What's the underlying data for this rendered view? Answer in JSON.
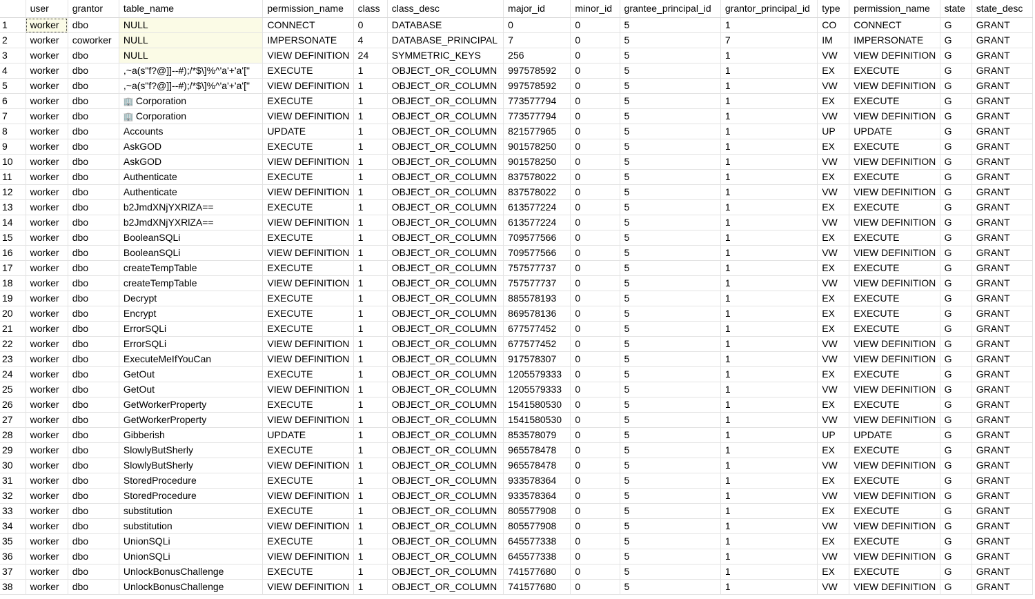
{
  "columns": [
    "",
    "user",
    "grantor",
    "table_name",
    "permission_name",
    "class",
    "class_desc",
    "major_id",
    "minor_id",
    "grantee_principal_id",
    "grantor_principal_id",
    "type",
    "permission_name",
    "state",
    "state_desc"
  ],
  "rows": [
    [
      "1",
      "worker",
      "dbo",
      "NULL",
      "CONNECT",
      "0",
      "DATABASE",
      "0",
      "0",
      "5",
      "1",
      "CO",
      "CONNECT",
      "G",
      "GRANT"
    ],
    [
      "2",
      "worker",
      "coworker",
      "NULL",
      "IMPERSONATE",
      "4",
      "DATABASE_PRINCIPAL",
      "7",
      "0",
      "5",
      "7",
      "IM",
      "IMPERSONATE",
      "G",
      "GRANT"
    ],
    [
      "3",
      "worker",
      "dbo",
      "NULL",
      "VIEW DEFINITION",
      "24",
      "SYMMETRIC_KEYS",
      "256",
      "0",
      "5",
      "1",
      "VW",
      "VIEW DEFINITION",
      "G",
      "GRANT"
    ],
    [
      "4",
      "worker",
      "dbo",
      " ,~a(s\"f?@]]--#);/*$\\]%^'a'+'a'[\"",
      "EXECUTE",
      "1",
      "OBJECT_OR_COLUMN",
      "997578592",
      "0",
      "5",
      "1",
      "EX",
      "EXECUTE",
      "G",
      "GRANT"
    ],
    [
      "5",
      "worker",
      "dbo",
      " ,~a(s\"f?@]]--#);/*$\\]%^'a'+'a'[\"",
      "VIEW DEFINITION",
      "1",
      "OBJECT_OR_COLUMN",
      "997578592",
      "0",
      "5",
      "1",
      "VW",
      "VIEW DEFINITION",
      "G",
      "GRANT"
    ],
    [
      "6",
      "worker",
      "dbo",
      "Corporation",
      "EXECUTE",
      "1",
      "OBJECT_OR_COLUMN",
      "773577794",
      "0",
      "5",
      "1",
      "EX",
      "EXECUTE",
      "G",
      "GRANT"
    ],
    [
      "7",
      "worker",
      "dbo",
      "Corporation",
      "VIEW DEFINITION",
      "1",
      "OBJECT_OR_COLUMN",
      "773577794",
      "0",
      "5",
      "1",
      "VW",
      "VIEW DEFINITION",
      "G",
      "GRANT"
    ],
    [
      "8",
      "worker",
      "dbo",
      "Accounts",
      "UPDATE",
      "1",
      "OBJECT_OR_COLUMN",
      "821577965",
      "0",
      "5",
      "1",
      "UP",
      "UPDATE",
      "G",
      "GRANT"
    ],
    [
      "9",
      "worker",
      "dbo",
      "AskGOD",
      "EXECUTE",
      "1",
      "OBJECT_OR_COLUMN",
      "901578250",
      "0",
      "5",
      "1",
      "EX",
      "EXECUTE",
      "G",
      "GRANT"
    ],
    [
      "10",
      "worker",
      "dbo",
      "AskGOD",
      "VIEW DEFINITION",
      "1",
      "OBJECT_OR_COLUMN",
      "901578250",
      "0",
      "5",
      "1",
      "VW",
      "VIEW DEFINITION",
      "G",
      "GRANT"
    ],
    [
      "11",
      "worker",
      "dbo",
      "Authenticate",
      "EXECUTE",
      "1",
      "OBJECT_OR_COLUMN",
      "837578022",
      "0",
      "5",
      "1",
      "EX",
      "EXECUTE",
      "G",
      "GRANT"
    ],
    [
      "12",
      "worker",
      "dbo",
      "Authenticate",
      "VIEW DEFINITION",
      "1",
      "OBJECT_OR_COLUMN",
      "837578022",
      "0",
      "5",
      "1",
      "VW",
      "VIEW DEFINITION",
      "G",
      "GRANT"
    ],
    [
      "13",
      "worker",
      "dbo",
      "b2JmdXNjYXRlZA==",
      "EXECUTE",
      "1",
      "OBJECT_OR_COLUMN",
      "613577224",
      "0",
      "5",
      "1",
      "EX",
      "EXECUTE",
      "G",
      "GRANT"
    ],
    [
      "14",
      "worker",
      "dbo",
      "b2JmdXNjYXRlZA==",
      "VIEW DEFINITION",
      "1",
      "OBJECT_OR_COLUMN",
      "613577224",
      "0",
      "5",
      "1",
      "VW",
      "VIEW DEFINITION",
      "G",
      "GRANT"
    ],
    [
      "15",
      "worker",
      "dbo",
      "BooleanSQLi",
      "EXECUTE",
      "1",
      "OBJECT_OR_COLUMN",
      "709577566",
      "0",
      "5",
      "1",
      "EX",
      "EXECUTE",
      "G",
      "GRANT"
    ],
    [
      "16",
      "worker",
      "dbo",
      "BooleanSQLi",
      "VIEW DEFINITION",
      "1",
      "OBJECT_OR_COLUMN",
      "709577566",
      "0",
      "5",
      "1",
      "VW",
      "VIEW DEFINITION",
      "G",
      "GRANT"
    ],
    [
      "17",
      "worker",
      "dbo",
      "createTempTable",
      "EXECUTE",
      "1",
      "OBJECT_OR_COLUMN",
      "757577737",
      "0",
      "5",
      "1",
      "EX",
      "EXECUTE",
      "G",
      "GRANT"
    ],
    [
      "18",
      "worker",
      "dbo",
      "createTempTable",
      "VIEW DEFINITION",
      "1",
      "OBJECT_OR_COLUMN",
      "757577737",
      "0",
      "5",
      "1",
      "VW",
      "VIEW DEFINITION",
      "G",
      "GRANT"
    ],
    [
      "19",
      "worker",
      "dbo",
      "Decrypt",
      "EXECUTE",
      "1",
      "OBJECT_OR_COLUMN",
      "885578193",
      "0",
      "5",
      "1",
      "EX",
      "EXECUTE",
      "G",
      "GRANT"
    ],
    [
      "20",
      "worker",
      "dbo",
      "Encrypt",
      "EXECUTE",
      "1",
      "OBJECT_OR_COLUMN",
      "869578136",
      "0",
      "5",
      "1",
      "EX",
      "EXECUTE",
      "G",
      "GRANT"
    ],
    [
      "21",
      "worker",
      "dbo",
      "ErrorSQLi",
      "EXECUTE",
      "1",
      "OBJECT_OR_COLUMN",
      "677577452",
      "0",
      "5",
      "1",
      "EX",
      "EXECUTE",
      "G",
      "GRANT"
    ],
    [
      "22",
      "worker",
      "dbo",
      "ErrorSQLi",
      "VIEW DEFINITION",
      "1",
      "OBJECT_OR_COLUMN",
      "677577452",
      "0",
      "5",
      "1",
      "VW",
      "VIEW DEFINITION",
      "G",
      "GRANT"
    ],
    [
      "23",
      "worker",
      "dbo",
      "ExecuteMeIfYouCan",
      "VIEW DEFINITION",
      "1",
      "OBJECT_OR_COLUMN",
      "917578307",
      "0",
      "5",
      "1",
      "VW",
      "VIEW DEFINITION",
      "G",
      "GRANT"
    ],
    [
      "24",
      "worker",
      "dbo",
      "GetOut",
      "EXECUTE",
      "1",
      "OBJECT_OR_COLUMN",
      "1205579333",
      "0",
      "5",
      "1",
      "EX",
      "EXECUTE",
      "G",
      "GRANT"
    ],
    [
      "25",
      "worker",
      "dbo",
      "GetOut",
      "VIEW DEFINITION",
      "1",
      "OBJECT_OR_COLUMN",
      "1205579333",
      "0",
      "5",
      "1",
      "VW",
      "VIEW DEFINITION",
      "G",
      "GRANT"
    ],
    [
      "26",
      "worker",
      "dbo",
      "GetWorkerProperty",
      "EXECUTE",
      "1",
      "OBJECT_OR_COLUMN",
      "1541580530",
      "0",
      "5",
      "1",
      "EX",
      "EXECUTE",
      "G",
      "GRANT"
    ],
    [
      "27",
      "worker",
      "dbo",
      "GetWorkerProperty",
      "VIEW DEFINITION",
      "1",
      "OBJECT_OR_COLUMN",
      "1541580530",
      "0",
      "5",
      "1",
      "VW",
      "VIEW DEFINITION",
      "G",
      "GRANT"
    ],
    [
      "28",
      "worker",
      "dbo",
      "Gibberish",
      "UPDATE",
      "1",
      "OBJECT_OR_COLUMN",
      "853578079",
      "0",
      "5",
      "1",
      "UP",
      "UPDATE",
      "G",
      "GRANT"
    ],
    [
      "29",
      "worker",
      "dbo",
      "SlowlyButSherly",
      "EXECUTE",
      "1",
      "OBJECT_OR_COLUMN",
      "965578478",
      "0",
      "5",
      "1",
      "EX",
      "EXECUTE",
      "G",
      "GRANT"
    ],
    [
      "30",
      "worker",
      "dbo",
      "SlowlyButSherly",
      "VIEW DEFINITION",
      "1",
      "OBJECT_OR_COLUMN",
      "965578478",
      "0",
      "5",
      "1",
      "VW",
      "VIEW DEFINITION",
      "G",
      "GRANT"
    ],
    [
      "31",
      "worker",
      "dbo",
      "StoredProcedure",
      "EXECUTE",
      "1",
      "OBJECT_OR_COLUMN",
      "933578364",
      "0",
      "5",
      "1",
      "EX",
      "EXECUTE",
      "G",
      "GRANT"
    ],
    [
      "32",
      "worker",
      "dbo",
      "StoredProcedure",
      "VIEW DEFINITION",
      "1",
      "OBJECT_OR_COLUMN",
      "933578364",
      "0",
      "5",
      "1",
      "VW",
      "VIEW DEFINITION",
      "G",
      "GRANT"
    ],
    [
      "33",
      "worker",
      "dbo",
      "substitution",
      "EXECUTE",
      "1",
      "OBJECT_OR_COLUMN",
      "805577908",
      "0",
      "5",
      "1",
      "EX",
      "EXECUTE",
      "G",
      "GRANT"
    ],
    [
      "34",
      "worker",
      "dbo",
      "substitution",
      "VIEW DEFINITION",
      "1",
      "OBJECT_OR_COLUMN",
      "805577908",
      "0",
      "5",
      "1",
      "VW",
      "VIEW DEFINITION",
      "G",
      "GRANT"
    ],
    [
      "35",
      "worker",
      "dbo",
      "UnionSQLi",
      "EXECUTE",
      "1",
      "OBJECT_OR_COLUMN",
      "645577338",
      "0",
      "5",
      "1",
      "EX",
      "EXECUTE",
      "G",
      "GRANT"
    ],
    [
      "36",
      "worker",
      "dbo",
      "UnionSQLi",
      "VIEW DEFINITION",
      "1",
      "OBJECT_OR_COLUMN",
      "645577338",
      "0",
      "5",
      "1",
      "VW",
      "VIEW DEFINITION",
      "G",
      "GRANT"
    ],
    [
      "37",
      "worker",
      "dbo",
      "UnlockBonusChallenge",
      "EXECUTE",
      "1",
      "OBJECT_OR_COLUMN",
      "741577680",
      "0",
      "5",
      "1",
      "EX",
      "EXECUTE",
      "G",
      "GRANT"
    ],
    [
      "38",
      "worker",
      "dbo",
      "UnlockBonusChallenge",
      "VIEW DEFINITION",
      "1",
      "OBJECT_OR_COLUMN",
      "741577680",
      "0",
      "5",
      "1",
      "VW",
      "VIEW DEFINITION",
      "G",
      "GRANT"
    ]
  ]
}
